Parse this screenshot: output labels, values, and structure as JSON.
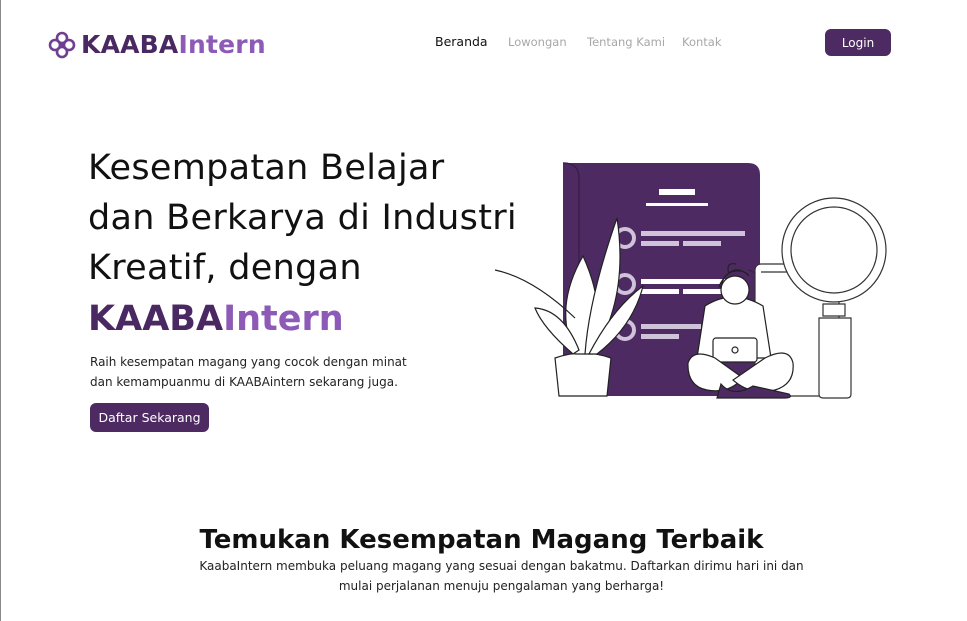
{
  "header": {
    "logo": {
      "part1": "KAABA",
      "part2": "Intern"
    },
    "nav": [
      {
        "label": "Beranda",
        "active": true
      },
      {
        "label": "Lowongan",
        "active": false
      },
      {
        "label": "Tentang Kami",
        "active": false
      },
      {
        "label": "Kontak",
        "active": false
      }
    ],
    "login_label": "Login"
  },
  "hero": {
    "title_lines": [
      "Kesempatan Belajar",
      "dan Berkarya di Industri",
      "Kreatif, dengan"
    ],
    "brand": {
      "part1": "KAABA",
      "part2": "Intern"
    },
    "subtitle_lines": [
      "Raih kesempatan magang yang cocok dengan minat",
      "dan kemampuanmu di KAABAintern sekarang juga."
    ],
    "cta_label": "Daftar Sekarang"
  },
  "section": {
    "title": "Temukan Kesempatan Magang Terbaik",
    "desc_lines": [
      "KaabaIntern membuka peluang magang yang sesuai dengan bakatmu. Daftarkan dirimu hari ini dan",
      "mulai perjalanan menuju pengalaman yang berharga!"
    ]
  },
  "colors": {
    "brand_dark": "#4a2861",
    "brand_light": "#8e5ab8",
    "button": "#4e2a63",
    "nav_inactive": "#a7a7a7"
  }
}
